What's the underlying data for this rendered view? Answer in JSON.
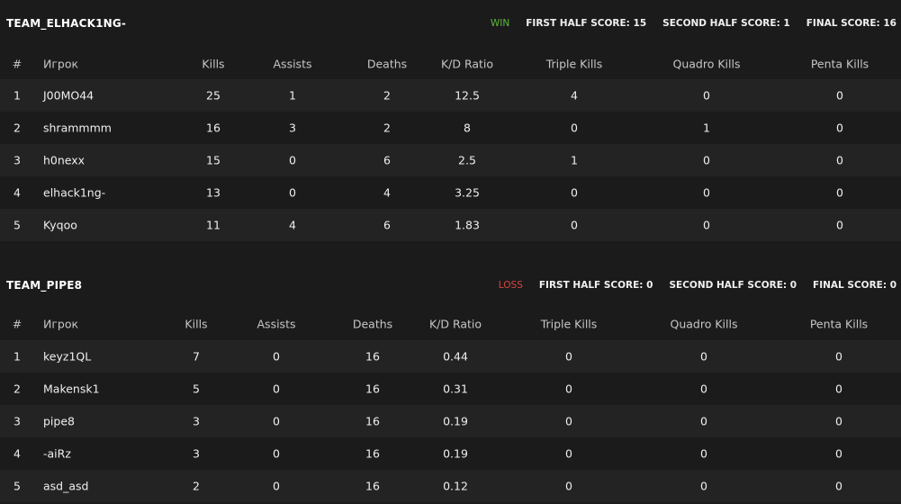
{
  "teams": [
    {
      "name": "TEAM_ELHACK1NG-",
      "result": "WIN",
      "first_half": "FIRST HALF SCORE: 15",
      "second_half": "SECOND HALF SCORE: 1",
      "final": "FINAL SCORE: 16",
      "headers": [
        "#",
        "Игрок",
        "Kills",
        "Assists",
        "Deaths",
        "K/D Ratio",
        "Triple Kills",
        "Quadro Kills",
        "Penta Kills"
      ],
      "rows": [
        [
          "1",
          "J00MO44",
          "25",
          "1",
          "2",
          "12.5",
          "4",
          "0",
          "0"
        ],
        [
          "2",
          "shrammmm",
          "16",
          "3",
          "2",
          "8",
          "0",
          "1",
          "0"
        ],
        [
          "3",
          "h0nexx",
          "15",
          "0",
          "6",
          "2.5",
          "1",
          "0",
          "0"
        ],
        [
          "4",
          "elhack1ng-",
          "13",
          "0",
          "4",
          "3.25",
          "0",
          "0",
          "0"
        ],
        [
          "5",
          "Kyqoo",
          "11",
          "4",
          "6",
          "1.83",
          "0",
          "0",
          "0"
        ]
      ]
    },
    {
      "name": "TEAM_PIPE8",
      "result": "LOSS",
      "first_half": "FIRST HALF SCORE: 0",
      "second_half": "SECOND HALF SCORE: 0",
      "final": "FINAL SCORE: 0",
      "headers": [
        "#",
        "Игрок",
        "Kills",
        "Assists",
        "Deaths",
        "K/D Ratio",
        "Triple Kills",
        "Quadro Kills",
        "Penta Kills"
      ],
      "rows": [
        [
          "1",
          "keyz1QL",
          "7",
          "0",
          "16",
          "0.44",
          "0",
          "0",
          "0"
        ],
        [
          "2",
          "Makensk1",
          "5",
          "0",
          "16",
          "0.31",
          "0",
          "0",
          "0"
        ],
        [
          "3",
          "pipe8",
          "3",
          "0",
          "16",
          "0.19",
          "0",
          "0",
          "0"
        ],
        [
          "4",
          "-aiRz",
          "3",
          "0",
          "16",
          "0.19",
          "0",
          "0",
          "0"
        ],
        [
          "5",
          "asd_asd",
          "2",
          "0",
          "16",
          "0.12",
          "0",
          "0",
          "0"
        ]
      ]
    }
  ],
  "colors": {
    "background": "#1b1b1b",
    "row_alt": "#232323",
    "win": "#5fb83a",
    "loss": "#d9433f"
  }
}
